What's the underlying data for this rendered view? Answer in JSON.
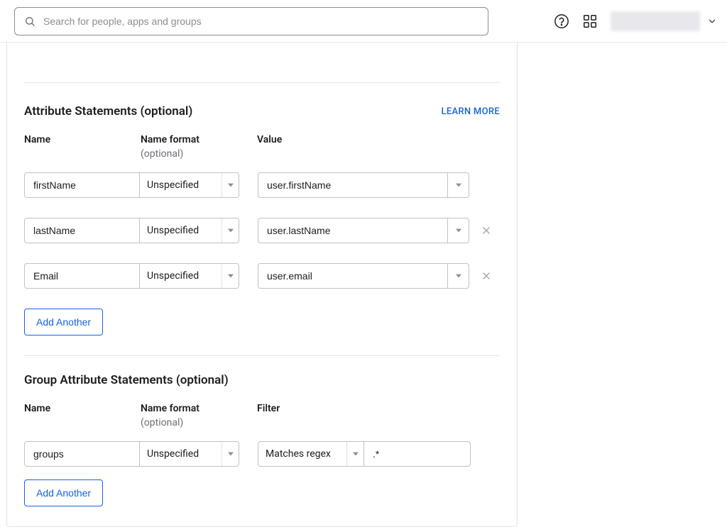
{
  "search": {
    "placeholder": "Search for people, apps and groups"
  },
  "attribute_section": {
    "title": "Attribute Statements (optional)",
    "learn_more": "LEARN MORE",
    "headers": {
      "name": "Name",
      "format": "Name format",
      "format_sub": "(optional)",
      "value": "Value"
    },
    "rows": [
      {
        "name": "firstName",
        "format": "Unspecified",
        "value": "user.firstName",
        "removable": false
      },
      {
        "name": "lastName",
        "format": "Unspecified",
        "value": "user.lastName",
        "removable": true
      },
      {
        "name": "Email",
        "format": "Unspecified",
        "value": "user.email",
        "removable": true
      }
    ],
    "add_label": "Add Another"
  },
  "group_section": {
    "title": "Group Attribute Statements (optional)",
    "headers": {
      "name": "Name",
      "format": "Name format",
      "format_sub": "(optional)",
      "filter": "Filter"
    },
    "rows": [
      {
        "name": "groups",
        "format": "Unspecified",
        "filter_type": "Matches regex",
        "filter_value": ".*"
      }
    ],
    "add_label": "Add Another"
  }
}
